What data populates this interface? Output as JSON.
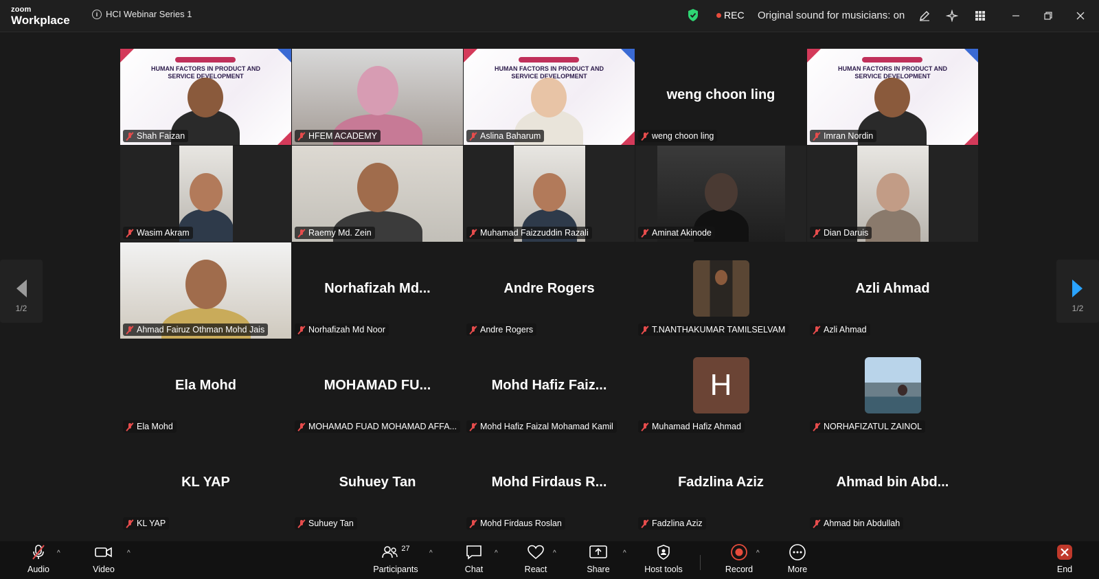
{
  "app": {
    "logo_small": "zoom",
    "logo_big": "Workplace",
    "meeting_title": "HCI Webinar Series 1"
  },
  "topbar": {
    "rec_label": "REC",
    "original_sound": "Original sound for musicians: on",
    "icons": [
      "shield-check-icon",
      "pencil-icon",
      "sparkle-icon",
      "apps-grid-icon",
      "minimize-icon",
      "restore-icon",
      "close-icon"
    ]
  },
  "slide": {
    "line1": "HUMAN FACTORS IN PRODUCT AND",
    "line2": "SERVICE DEVELOPMENT"
  },
  "participants": [
    {
      "label": "Shah Faizan",
      "big": "",
      "kind": "slide-video"
    },
    {
      "label": "HFEM ACADEMY",
      "big": "",
      "kind": "video"
    },
    {
      "label": "Aslina Baharum",
      "big": "",
      "kind": "slide-video",
      "active": true
    },
    {
      "label": "weng choon ling",
      "big": "weng choon ling",
      "kind": "name"
    },
    {
      "label": "Imran Nordin",
      "big": "",
      "kind": "slide-video"
    },
    {
      "label": "Wasim Akram",
      "big": "",
      "kind": "video-narrow"
    },
    {
      "label": "Raemy Md. Zein",
      "big": "",
      "kind": "video"
    },
    {
      "label": "Muhamad Faizzuddin Razali",
      "big": "",
      "kind": "video-narrow"
    },
    {
      "label": "Aminat Akinode",
      "big": "",
      "kind": "video-dark"
    },
    {
      "label": "Dian Daruis",
      "big": "",
      "kind": "video-narrow"
    },
    {
      "label": "Ahmad Fairuz Othman Mohd Jais",
      "big": "",
      "kind": "video"
    },
    {
      "label": "Norhafizah Md Noor",
      "big": "Norhafizah  Md...",
      "kind": "name"
    },
    {
      "label": "Andre Rogers",
      "big": "Andre Rogers",
      "kind": "name"
    },
    {
      "label": "T.NANTHAKUMAR TAMILSELVAM",
      "big": "",
      "kind": "photo"
    },
    {
      "label": "Azli Ahmad",
      "big": "Azli Ahmad",
      "kind": "name"
    },
    {
      "label": "Ela Mohd",
      "big": "Ela Mohd",
      "kind": "name"
    },
    {
      "label": "MOHAMAD FUAD MOHAMAD AFFA...",
      "big": "MOHAMAD  FU...",
      "kind": "name"
    },
    {
      "label": "Mohd Hafiz Faizal Mohamad Kamil",
      "big": "Mohd Hafiz Faiz...",
      "kind": "name"
    },
    {
      "label": "Muhamad Hafiz Ahmad",
      "big": "H",
      "kind": "avatar"
    },
    {
      "label": "NORHAFIZATUL ZAINOL",
      "big": "",
      "kind": "photo2"
    },
    {
      "label": "KL YAP",
      "big": "KL YAP",
      "kind": "name"
    },
    {
      "label": "Suhuey Tan",
      "big": "Suhuey Tan",
      "kind": "name"
    },
    {
      "label": "Mohd Firdaus Roslan",
      "big": "Mohd Firdaus R...",
      "kind": "name"
    },
    {
      "label": "Fadzlina Aziz",
      "big": "Fadzlina Aziz",
      "kind": "name"
    },
    {
      "label": "Ahmad bin Abdullah",
      "big": "Ahmad bin Abd...",
      "kind": "name"
    }
  ],
  "pager": {
    "left": "1/2",
    "right": "1/2"
  },
  "toolbar": {
    "audio": "Audio",
    "video": "Video",
    "participants": "Participants",
    "participants_count": "27",
    "chat": "Chat",
    "react": "React",
    "share": "Share",
    "host_tools": "Host tools",
    "record": "Record",
    "more": "More",
    "end": "End"
  },
  "colors": {
    "accent_green": "#2ed573",
    "rec_red": "#e74c3c",
    "pager_blue": "#2aa3ff"
  }
}
